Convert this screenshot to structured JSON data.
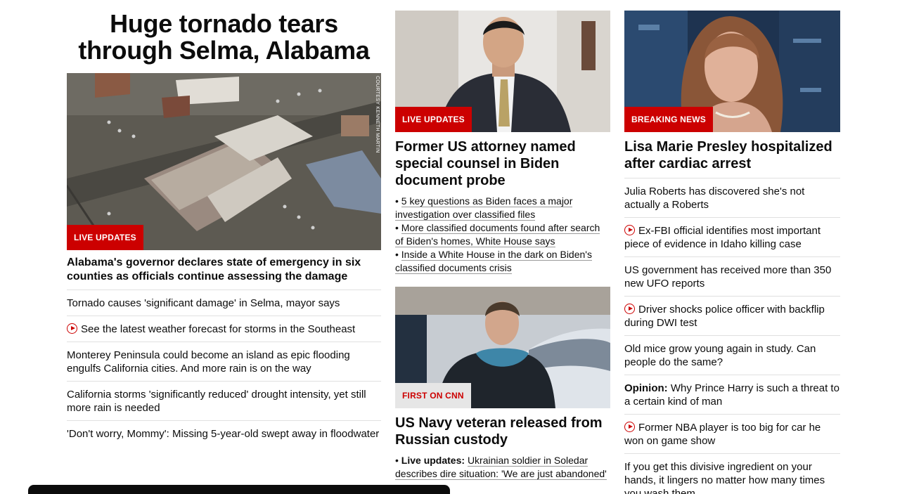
{
  "col1": {
    "headline": "Huge tornado tears through Selma, Alabama",
    "badge": "LIVE UPDATES",
    "credit": "COURTESY KENNETH MARTIN",
    "lead": "Alabama's governor declares state of emergency in six counties as officials continue assessing the damage",
    "items": [
      {
        "text": "Tornado causes 'significant damage' in Selma, mayor says",
        "video": false
      },
      {
        "text": "See the latest weather forecast for storms in the Southeast",
        "video": true
      },
      {
        "text": "Monterey Peninsula could become an island as epic flooding engulfs California cities. And more rain is on the way",
        "video": false
      },
      {
        "text": "California storms 'significantly reduced' drought intensity, yet still more rain is needed",
        "video": false
      },
      {
        "text": "'Don't worry, Mommy': Missing 5-year-old swept away in floodwater",
        "video": false
      }
    ]
  },
  "col2": {
    "story1": {
      "badge": "LIVE UPDATES",
      "headline": "Former US attorney named special counsel in Biden document probe",
      "bullets": [
        "5 key questions as Biden faces a major investigation over classified files",
        "More classified documents found after search of Biden's homes, White House says",
        "Inside a White House in the dark on Biden's classified documents crisis"
      ]
    },
    "story2": {
      "badge": "FIRST ON CNN",
      "headline": "US Navy veteran released from Russian custody",
      "bullet_label": "Live updates:",
      "bullet_text": "Ukrainian soldier in Soledar describes dire situation: 'We are just abandoned'"
    }
  },
  "col3": {
    "badge": "BREAKING NEWS",
    "headline": "Lisa Marie Presley hospitalized after cardiac arrest",
    "items": [
      {
        "label": "",
        "text": "Julia Roberts has discovered she's not actually a Roberts",
        "video": false
      },
      {
        "label": "",
        "text": "Ex-FBI official identifies most important piece of evidence in Idaho killing case",
        "video": true
      },
      {
        "label": "",
        "text": "US government has received more than 350 new UFO reports",
        "video": false
      },
      {
        "label": "",
        "text": "Driver shocks police officer with backflip during DWI test",
        "video": true
      },
      {
        "label": "",
        "text": "Old mice grow young again in study. Can people do the same?",
        "video": false
      },
      {
        "label": "Opinion:",
        "text": "Why Prince Harry is such a threat to a certain kind of man",
        "video": false
      },
      {
        "label": "",
        "text": "Former NBA player is too big for car he won on game show",
        "video": true
      },
      {
        "label": "",
        "text": "If you get this divisive ingredient on your hands, it lingers no matter how many times you wash them",
        "video": false
      }
    ]
  },
  "colors": {
    "accent": "#cc0000",
    "text": "#0c0c0c",
    "divider": "#e0e0e0"
  }
}
